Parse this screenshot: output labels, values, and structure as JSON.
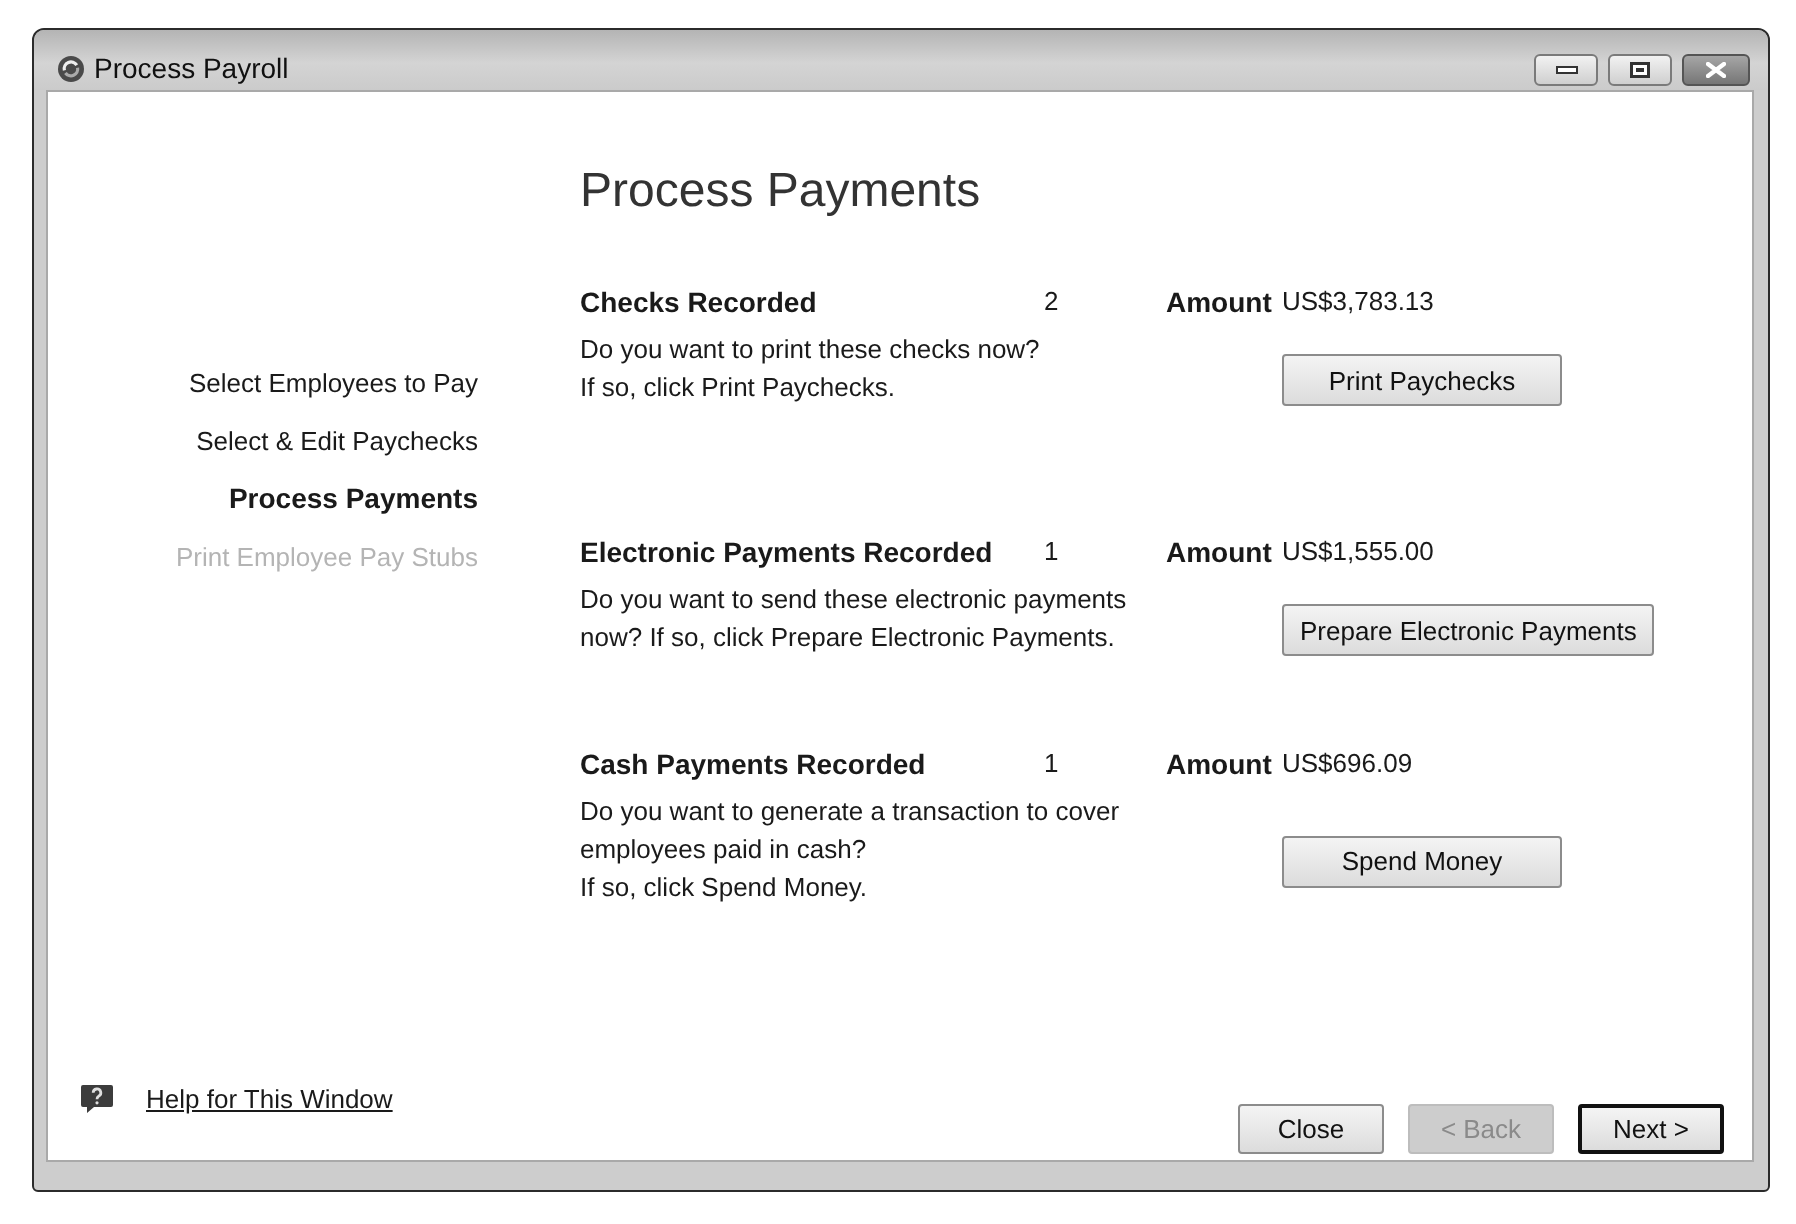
{
  "window": {
    "title": "Process Payroll"
  },
  "steps": [
    {
      "label": "Select Employees to Pay",
      "selected": false,
      "disabled": false
    },
    {
      "label": "Select & Edit Paychecks",
      "selected": false,
      "disabled": false
    },
    {
      "label": "Process Payments",
      "selected": true,
      "disabled": false
    },
    {
      "label": "Print Employee Pay Stubs",
      "selected": false,
      "disabled": true
    }
  ],
  "heading": "Process Payments",
  "sections": [
    {
      "title": "Checks Recorded",
      "count": "2",
      "amount_label": "Amount",
      "amount": "US$3,783.13",
      "description": "Do you want to print these checks now?\nIf so, click Print Paychecks.",
      "button": "Print Paychecks"
    },
    {
      "title": "Electronic Payments Recorded",
      "count": "1",
      "amount_label": "Amount",
      "amount": "US$1,555.00",
      "description": "Do you want to send these electronic payments\nnow? If so, click Prepare Electronic Payments.",
      "button": "Prepare Electronic Payments"
    },
    {
      "title": "Cash Payments Recorded",
      "count": "1",
      "amount_label": "Amount",
      "amount": "US$696.09",
      "description": "Do you want to generate a transaction to cover\nemployees paid in cash?\nIf so, click Spend Money.",
      "button": "Spend Money"
    }
  ],
  "help_link": "Help for This Window",
  "buttons": [
    {
      "label": "Close",
      "disabled": false,
      "default": false
    },
    {
      "label": "< Back",
      "disabled": true,
      "default": false
    },
    {
      "label": "Next >",
      "disabled": false,
      "default": true
    }
  ]
}
